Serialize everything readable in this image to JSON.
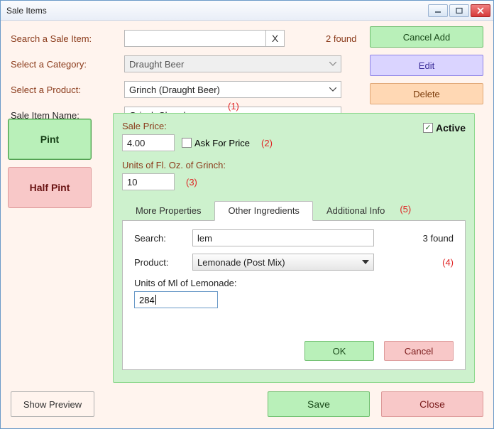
{
  "window": {
    "title": "Sale Items"
  },
  "search": {
    "label": "Search a Sale Item:",
    "value": "",
    "clear": "X",
    "found": "2 found"
  },
  "category": {
    "label": "Select a Category:",
    "value": "Draught Beer"
  },
  "product": {
    "label": "Select a Product:",
    "value": "Grinch (Draught Beer)"
  },
  "itemname": {
    "label": "Sale Item Name:",
    "value": "Grinch Shandy"
  },
  "ann": {
    "a1": "(1)",
    "a2": "(2)",
    "a3": "(3)",
    "a4": "(4)",
    "a5": "(5)"
  },
  "actions": {
    "cancel_add": "Cancel Add",
    "edit": "Edit",
    "delete": "Delete"
  },
  "sizes": {
    "pint": "Pint",
    "halfpint": "Half Pint"
  },
  "panel": {
    "price_label": "Sale Price:",
    "price_value": "4.00",
    "ask_label": "Ask For Price",
    "active_label": "Active",
    "units_label": "Units of Fl. Oz. of Grinch:",
    "units_value": "10"
  },
  "tabs": {
    "more": "More Properties",
    "other": "Other Ingredients",
    "info": "Additional Info"
  },
  "ingred": {
    "search_label": "Search:",
    "search_value": "lem",
    "found": "3 found",
    "product_label": "Product:",
    "product_value": "Lemonade (Post Mix)",
    "units_label": "Units of Ml of Lemonade:",
    "units_value": "284",
    "ok": "OK",
    "cancel": "Cancel"
  },
  "bottom": {
    "preview": "Show Preview",
    "save": "Save",
    "close": "Close"
  }
}
